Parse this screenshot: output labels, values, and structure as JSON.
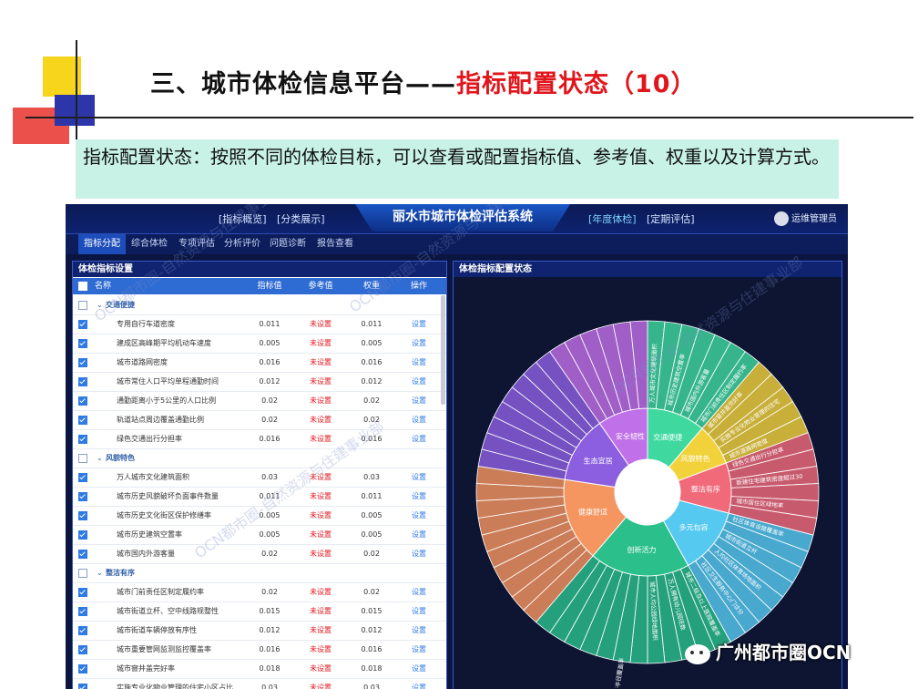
{
  "slide": {
    "title_main": "三、城市体检信息平台——",
    "title_highlight": "指标配置状态（10）",
    "description": "指标配置状态：按照不同的体检目标，可以查看或配置指标值、参考值、权重以及计算方式。"
  },
  "app": {
    "system_title": "丽水市城市体检评估系统",
    "top_buttons": [
      "[指标概览]",
      "[分类展示]",
      "[年度体检]",
      "[定期评估]"
    ],
    "user_name": "运维管理员",
    "tabs": [
      "指标分配",
      "综合体检",
      "专项评估",
      "分析评价",
      "问题诊断",
      "报告查看"
    ],
    "active_tab": "指标分配"
  },
  "left_panel": {
    "title": "体检指标设置",
    "columns": [
      "名称",
      "指标值",
      "参考值",
      "权重",
      "操作"
    ],
    "rows": [
      {
        "type": "group",
        "name": "交通便捷"
      },
      {
        "type": "item",
        "name": "专用自行车道密度",
        "value": "0.011",
        "ref": "未设置",
        "weight": "0.011",
        "op": "设置"
      },
      {
        "type": "item",
        "name": "建成区高峰期平均机动车速度",
        "value": "0.005",
        "ref": "未设置",
        "weight": "0.005",
        "op": "设置"
      },
      {
        "type": "item",
        "name": "城市道路网密度",
        "value": "0.016",
        "ref": "未设置",
        "weight": "0.016",
        "op": "设置"
      },
      {
        "type": "item",
        "name": "城市常住人口平均单程通勤时间",
        "value": "0.012",
        "ref": "未设置",
        "weight": "0.012",
        "op": "设置"
      },
      {
        "type": "item",
        "name": "通勤距离小于5公里的人口比例",
        "value": "0.02",
        "ref": "未设置",
        "weight": "0.02",
        "op": "设置"
      },
      {
        "type": "item",
        "name": "轨道站点周边覆盖通勤比例",
        "value": "0.02",
        "ref": "未设置",
        "weight": "0.02",
        "op": "设置"
      },
      {
        "type": "item",
        "name": "绿色交通出行分担率",
        "value": "0.016",
        "ref": "未设置",
        "weight": "0.016",
        "op": "设置"
      },
      {
        "type": "group",
        "name": "风貌特色"
      },
      {
        "type": "item",
        "name": "万人城市文化建筑面积",
        "value": "0.03",
        "ref": "未设置",
        "weight": "0.03",
        "op": "设置"
      },
      {
        "type": "item",
        "name": "城市历史风貌破坏负面事件数量",
        "value": "0.011",
        "ref": "未设置",
        "weight": "0.011",
        "op": "设置"
      },
      {
        "type": "item",
        "name": "城市历史文化街区保护修缮率",
        "value": "0.005",
        "ref": "未设置",
        "weight": "0.005",
        "op": "设置"
      },
      {
        "type": "item",
        "name": "城市历史建筑空置率",
        "value": "0.005",
        "ref": "未设置",
        "weight": "0.005",
        "op": "设置"
      },
      {
        "type": "item",
        "name": "城市国内外游客量",
        "value": "0.02",
        "ref": "未设置",
        "weight": "0.02",
        "op": "设置"
      },
      {
        "type": "group",
        "name": "整洁有序"
      },
      {
        "type": "item",
        "name": "城市门前责任区制定履约率",
        "value": "0.02",
        "ref": "未设置",
        "weight": "0.02",
        "op": "设置"
      },
      {
        "type": "item",
        "name": "城市街道立杆、空中线路规整性",
        "value": "0.015",
        "ref": "未设置",
        "weight": "0.015",
        "op": "设置"
      },
      {
        "type": "item",
        "name": "城市街道车辆停放有序性",
        "value": "0.012",
        "ref": "未设置",
        "weight": "0.012",
        "op": "设置"
      },
      {
        "type": "item",
        "name": "城市重要管网监测监控覆盖率",
        "value": "0.016",
        "ref": "未设置",
        "weight": "0.016",
        "op": "设置"
      },
      {
        "type": "item",
        "name": "城市窨井盖完好率",
        "value": "0.018",
        "ref": "未设置",
        "weight": "0.018",
        "op": "设置"
      },
      {
        "type": "item",
        "name": "实施专业化物业管理的住宅小区占比",
        "value": "0.03",
        "ref": "未设置",
        "weight": "0.03",
        "op": "设置"
      }
    ]
  },
  "right_panel": {
    "title": "体检指标配置状态",
    "inner": [
      {
        "name": "交通便捷",
        "color": "#3fd9a0",
        "count": 7
      },
      {
        "name": "风貌特色",
        "color": "#f2d23a",
        "count": 5
      },
      {
        "name": "整洁有序",
        "color": "#f06a7a",
        "count": 6
      },
      {
        "name": "多元包容",
        "color": "#56c9f0",
        "count": 8
      },
      {
        "name": "创新活力",
        "color": "#2bbf8c",
        "count": 12
      },
      {
        "name": "健康舒适",
        "color": "#f59560",
        "count": 10
      },
      {
        "name": "生态宜居",
        "color": "#8c5fe0",
        "count": 8
      },
      {
        "name": "安全韧性",
        "color": "#c070e8",
        "count": 6
      }
    ],
    "outer_labels": [
      "万人城市文化建筑面积",
      "城市历史建筑空置率",
      "城市国内外游客量",
      "城市门前责任区制定履约率",
      "城市窨井盖完好率",
      "实施专业化物业管理的住宅",
      "城市道路网密度",
      "绿色交通出行分担率",
      "新建住宅建筑密度超过30",
      "城市居住区绿地率",
      "社区体育设施覆盖率",
      "城市街道立杆",
      "人均社区体育场地面积",
      "社区卫生服务中心门诊分",
      "城市二级及以上医院覆盖率",
      "万人拥有幼儿园班数",
      "城市人均公园绿地面积",
      "城市绿道服务半径覆盖率"
    ]
  },
  "footer": {
    "brand": "广州都市圈OCN",
    "watermark": "OCN都市圈-自然资源与住建事业部"
  }
}
